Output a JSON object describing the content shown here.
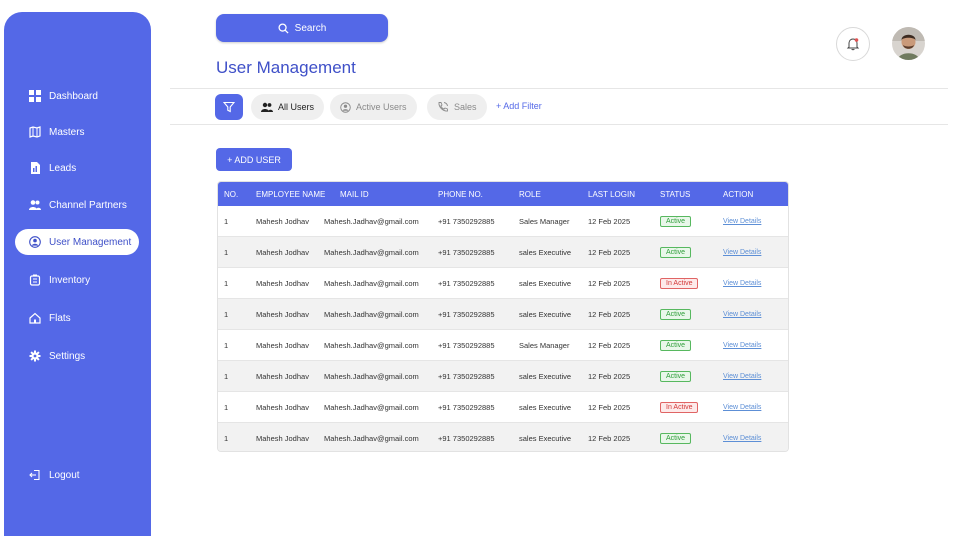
{
  "sidebar": {
    "items": [
      {
        "label": "Dashboard",
        "icon": "dashboard-icon",
        "active": false
      },
      {
        "label": "Masters",
        "icon": "map-icon",
        "active": false
      },
      {
        "label": "Leads",
        "icon": "document-icon",
        "active": false
      },
      {
        "label": "Channel Partners",
        "icon": "users-icon",
        "active": false
      },
      {
        "label": "User Management",
        "icon": "user-circle-icon",
        "active": true
      },
      {
        "label": "Inventory",
        "icon": "inventory-icon",
        "active": false
      },
      {
        "label": "Flats",
        "icon": "home-icon",
        "active": false
      },
      {
        "label": "Settings",
        "icon": "gear-icon",
        "active": false
      }
    ],
    "logout_label": "Logout"
  },
  "header": {
    "search_label": "Search",
    "page_title": "User Management"
  },
  "filters": {
    "chips": [
      {
        "label": "All Users",
        "selected": true
      },
      {
        "label": "Active Users",
        "selected": false
      },
      {
        "label": "Sales",
        "selected": false
      }
    ],
    "add_filter_label": "+ Add Filter"
  },
  "add_user_label": "+ ADD USER",
  "table": {
    "columns": [
      "NO.",
      "EMPLOYEE NAME",
      "MAIL ID",
      "PHONE NO.",
      "ROLE",
      "LAST LOGIN",
      "STATUS",
      "ACTION"
    ],
    "rows": [
      {
        "no": "1",
        "name": "Mahesh Jodhav",
        "mail": "Mahesh.Jadhav@gmail.com",
        "phone": "+91 7350292885",
        "role": "Sales Manager",
        "login": "12 Feb 2025",
        "status": "Active",
        "action": "View Details"
      },
      {
        "no": "1",
        "name": "Mahesh Jodhav",
        "mail": "Mahesh.Jadhav@gmail.com",
        "phone": "+91 7350292885",
        "role": "sales Executive",
        "login": "12 Feb 2025",
        "status": "Active",
        "action": "View Details"
      },
      {
        "no": "1",
        "name": "Mahesh Jodhav",
        "mail": "Mahesh.Jadhav@gmail.com",
        "phone": "+91 7350292885",
        "role": "sales Executive",
        "login": "12 Feb 2025",
        "status": "In Active",
        "action": "View Details"
      },
      {
        "no": "1",
        "name": "Mahesh Jodhav",
        "mail": "Mahesh.Jadhav@gmail.com",
        "phone": "+91 7350292885",
        "role": "sales Executive",
        "login": "12 Feb 2025",
        "status": "Active",
        "action": "View Details"
      },
      {
        "no": "1",
        "name": "Mahesh Jodhav",
        "mail": "Mahesh.Jadhav@gmail.com",
        "phone": "+91 7350292885",
        "role": "Sales Manager",
        "login": "12 Feb 2025",
        "status": "Active",
        "action": "View Details"
      },
      {
        "no": "1",
        "name": "Mahesh Jodhav",
        "mail": "Mahesh.Jadhav@gmail.com",
        "phone": "+91 7350292885",
        "role": "sales Executive",
        "login": "12 Feb 2025",
        "status": "Active",
        "action": "View Details"
      },
      {
        "no": "1",
        "name": "Mahesh Jodhav",
        "mail": "Mahesh.Jadhav@gmail.com",
        "phone": "+91 7350292885",
        "role": "sales Executive",
        "login": "12 Feb 2025",
        "status": "In Active",
        "action": "View Details"
      },
      {
        "no": "1",
        "name": "Mahesh Jodhav",
        "mail": "Mahesh.Jadhav@gmail.com",
        "phone": "+91 7350292885",
        "role": "sales Executive",
        "login": "12 Feb 2025",
        "status": "Active",
        "action": "View Details"
      }
    ]
  },
  "colors": {
    "primary": "#5468e7",
    "active_green": "#2f9e3a",
    "inactive_red": "#d23838",
    "notification_dot": "#e05252"
  }
}
